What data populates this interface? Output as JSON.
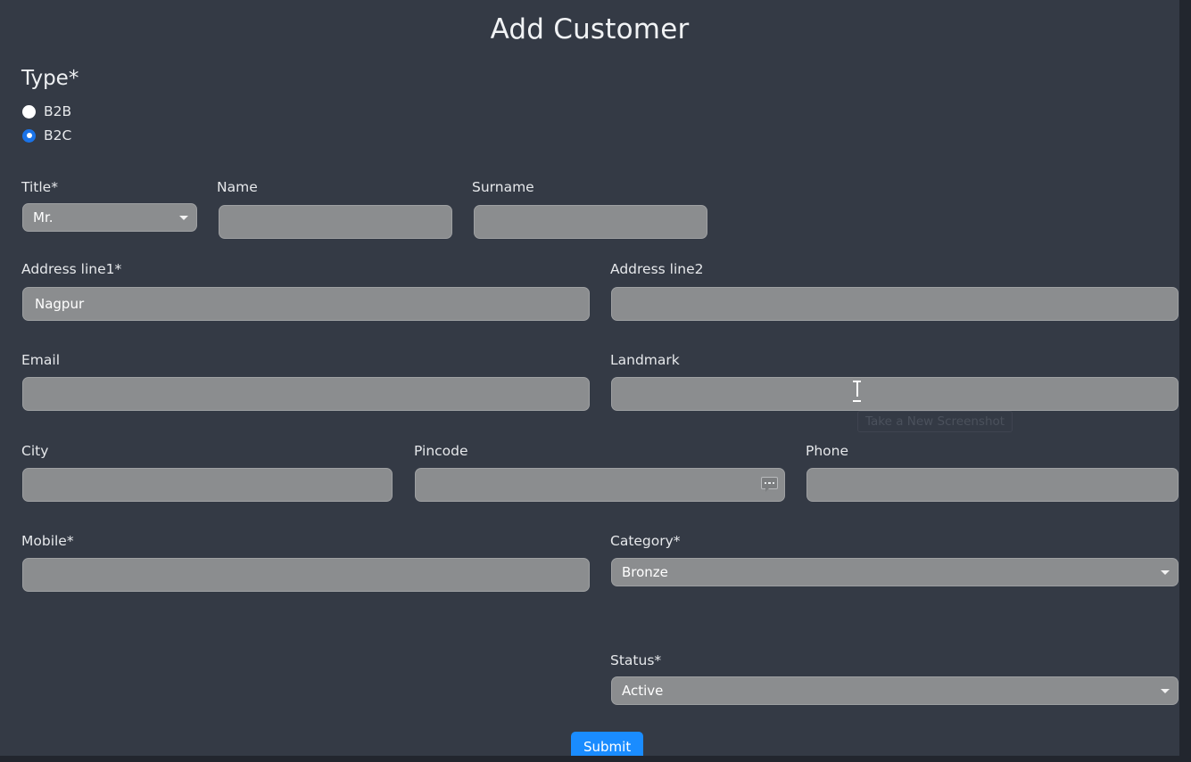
{
  "page": {
    "title": "Add Customer",
    "background_color": "#343a45",
    "field_background_color": "#8b8d8f",
    "accent_color": "#1a8cff"
  },
  "type_group": {
    "label": "Type*",
    "options": [
      {
        "label": "B2B",
        "selected": false
      },
      {
        "label": "B2C",
        "selected": true
      }
    ]
  },
  "fields": {
    "title": {
      "label": "Title*",
      "value": "Mr.",
      "control": "select",
      "caret_icon": "chevron-down-icon"
    },
    "name": {
      "label": "Name",
      "value": "",
      "placeholder": ""
    },
    "surname": {
      "label": "Surname",
      "value": "",
      "placeholder": ""
    },
    "address_line1": {
      "label": "Address line1*",
      "value": "Nagpur",
      "placeholder": ""
    },
    "address_line2": {
      "label": "Address line2",
      "value": "",
      "placeholder": ""
    },
    "email": {
      "label": "Email",
      "value": "",
      "placeholder": ""
    },
    "landmark": {
      "label": "Landmark",
      "value": "",
      "placeholder": ""
    },
    "city": {
      "label": "City",
      "value": "",
      "placeholder": ""
    },
    "pincode": {
      "label": "Pincode",
      "value": "",
      "placeholder": "",
      "hint_icon": "suggestion-bubble-icon"
    },
    "phone": {
      "label": "Phone",
      "value": "",
      "placeholder": ""
    },
    "mobile": {
      "label": "Mobile*",
      "value": "",
      "placeholder": ""
    },
    "category": {
      "label": "Category*",
      "value": "Bronze",
      "control": "select",
      "caret_icon": "chevron-down-icon"
    },
    "status": {
      "label": "Status*",
      "value": "Active",
      "control": "select",
      "caret_icon": "chevron-down-icon"
    }
  },
  "overlay": {
    "screenshot_button_label": "Take a New Screenshot"
  },
  "actions": {
    "submit_label": "Submit"
  }
}
